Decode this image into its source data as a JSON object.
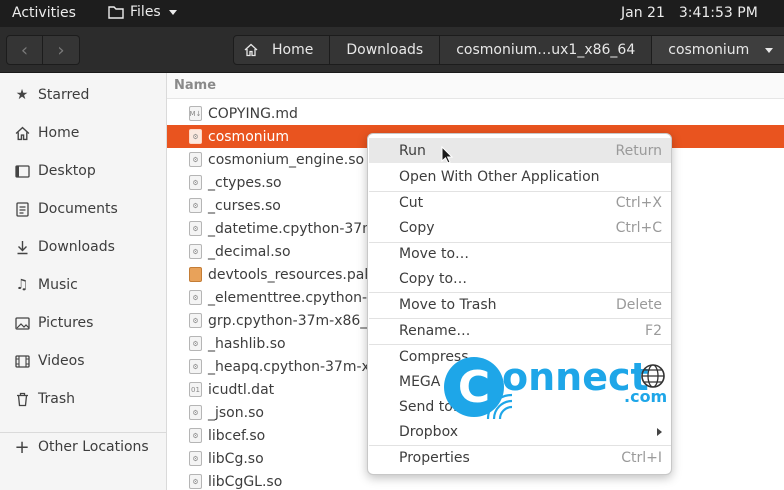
{
  "topbar": {
    "activities": "Activities",
    "app_name": "Files",
    "date": "Jan 21",
    "time": "3:41:53 PM"
  },
  "headerbar": {
    "back_glyph": "‹",
    "forward_glyph": "›",
    "breadcrumbs": [
      "Home",
      "Downloads",
      "cosmonium…ux1_x86_64",
      "cosmonium"
    ]
  },
  "sidebar": {
    "items": [
      {
        "label": "Starred",
        "icon": "star-icon"
      },
      {
        "label": "Home",
        "icon": "home-icon"
      },
      {
        "label": "Desktop",
        "icon": "desktop-icon"
      },
      {
        "label": "Documents",
        "icon": "documents-icon"
      },
      {
        "label": "Downloads",
        "icon": "downloads-icon"
      },
      {
        "label": "Music",
        "icon": "music-icon"
      },
      {
        "label": "Pictures",
        "icon": "pictures-icon"
      },
      {
        "label": "Videos",
        "icon": "videos-icon"
      },
      {
        "label": "Trash",
        "icon": "trash-icon"
      }
    ],
    "other_locations": "Other Locations"
  },
  "filelist": {
    "column_name": "Name",
    "files": [
      "COPYING.md",
      "cosmonium",
      "cosmonium_engine.so",
      "_ctypes.so",
      "_curses.so",
      "_datetime.cpython-37m",
      "_decimal.so",
      "devtools_resources.pak",
      "_elementtree.cpython-3",
      "grp.cpython-37m-x86_64",
      "_hashlib.so",
      "_heapq.cpython-37m-x8",
      "icudtl.dat",
      "_json.so",
      "libcef.so",
      "libCg.so",
      "libCgGL.so"
    ],
    "selected": "cosmonium"
  },
  "context_menu": {
    "run": {
      "label": "Run",
      "accel": "Return"
    },
    "open_with": {
      "label": "Open With Other Application"
    },
    "cut": {
      "label": "Cut",
      "accel": "Ctrl+X"
    },
    "copy": {
      "label": "Copy",
      "accel": "Ctrl+C"
    },
    "move_to": {
      "label": "Move to…"
    },
    "copy_to": {
      "label": "Copy to…"
    },
    "move_to_trash": {
      "label": "Move to Trash",
      "accel": "Delete"
    },
    "rename": {
      "label": "Rename…",
      "accel": "F2"
    },
    "compress": {
      "label": "Compress…"
    },
    "mega": {
      "label": "MEGA"
    },
    "send_to": {
      "label": "Send to…"
    },
    "dropbox": {
      "label": "Dropbox"
    },
    "properties": {
      "label": "Properties",
      "accel": "Ctrl+I"
    }
  },
  "watermark": {
    "letter": "C",
    "word": "onnect",
    "suffix": ".com"
  },
  "colors": {
    "selection": "#e9541f",
    "topbar": "#1d1d1d",
    "headerbar": "#2c2c2c",
    "watermark": "#1ea6e8"
  }
}
